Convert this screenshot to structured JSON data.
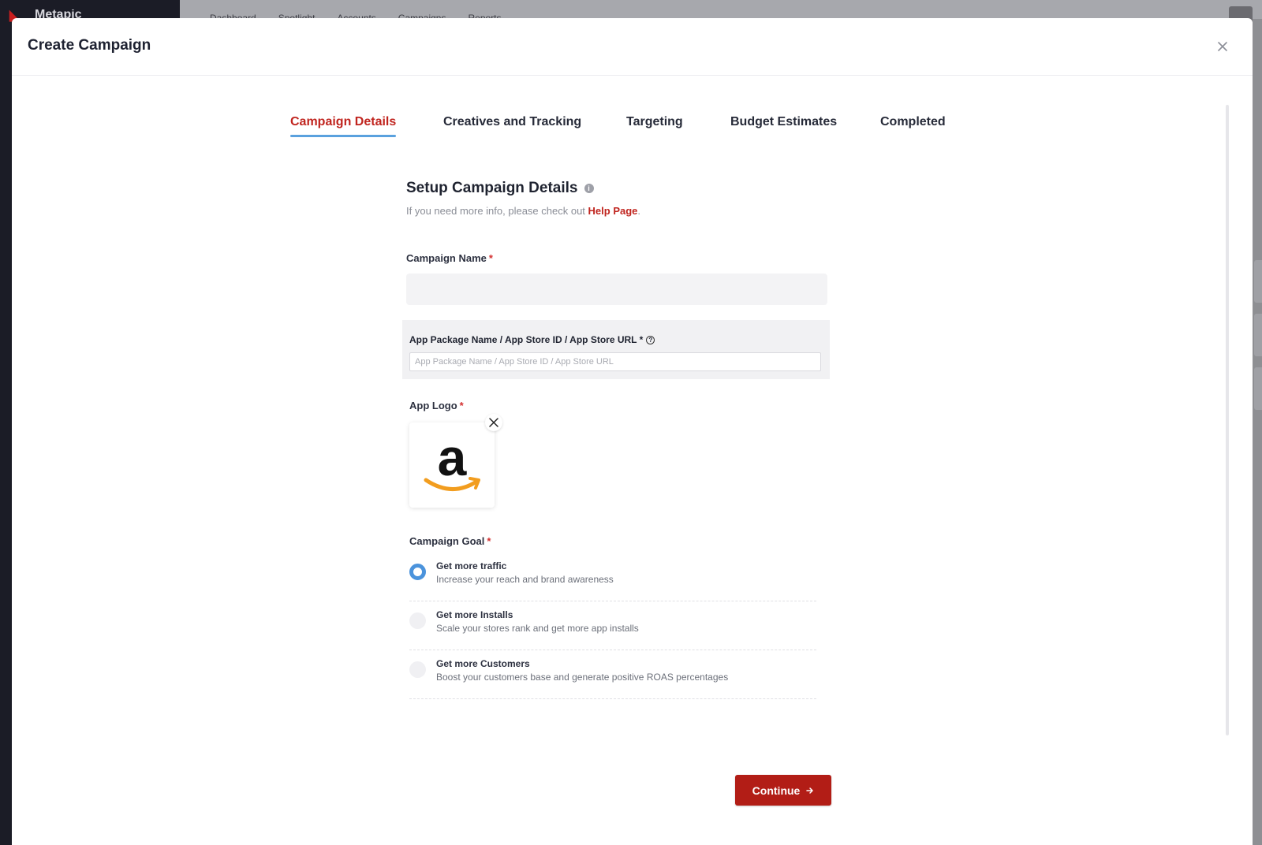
{
  "background": {
    "brand": "Metapic",
    "nav_items": [
      "Dashboard",
      "Spotlight",
      "Accounts",
      "Campaigns",
      "Reports"
    ]
  },
  "modal": {
    "title": "Create Campaign"
  },
  "steps": [
    {
      "label": "Campaign Details",
      "active": true
    },
    {
      "label": "Creatives and Tracking",
      "active": false
    },
    {
      "label": "Targeting",
      "active": false
    },
    {
      "label": "Budget Estimates",
      "active": false
    },
    {
      "label": "Completed",
      "active": false
    }
  ],
  "setup": {
    "title": "Setup Campaign Details",
    "subtitle_prefix": "If you need more info, please check out ",
    "help_link": "Help Page",
    "subtitle_suffix": "."
  },
  "form": {
    "campaign_name_label": "Campaign Name",
    "campaign_name_value": "",
    "package_label": "App Package Name / App Store ID / App Store URL *",
    "package_placeholder": "App Package Name / App Store ID / App Store URL",
    "logo_label": "App Logo",
    "logo_letter": "a",
    "goal_label": "Campaign Goal",
    "required_mark": "*",
    "goals": [
      {
        "title": "Get more traffic",
        "desc": "Increase your reach and brand awareness",
        "selected": true
      },
      {
        "title": "Get more Installs",
        "desc": "Scale your stores rank and get more app installs",
        "selected": false
      },
      {
        "title": "Get more Customers",
        "desc": "Boost your customers base and generate positive ROAS percentages",
        "selected": false
      }
    ]
  },
  "continue_label": "Continue",
  "colors": {
    "accent_red": "#b21d16",
    "active_tab": "#c0241e",
    "radio_blue": "#4b93dc",
    "amazon_orange": "#f29d1f"
  }
}
